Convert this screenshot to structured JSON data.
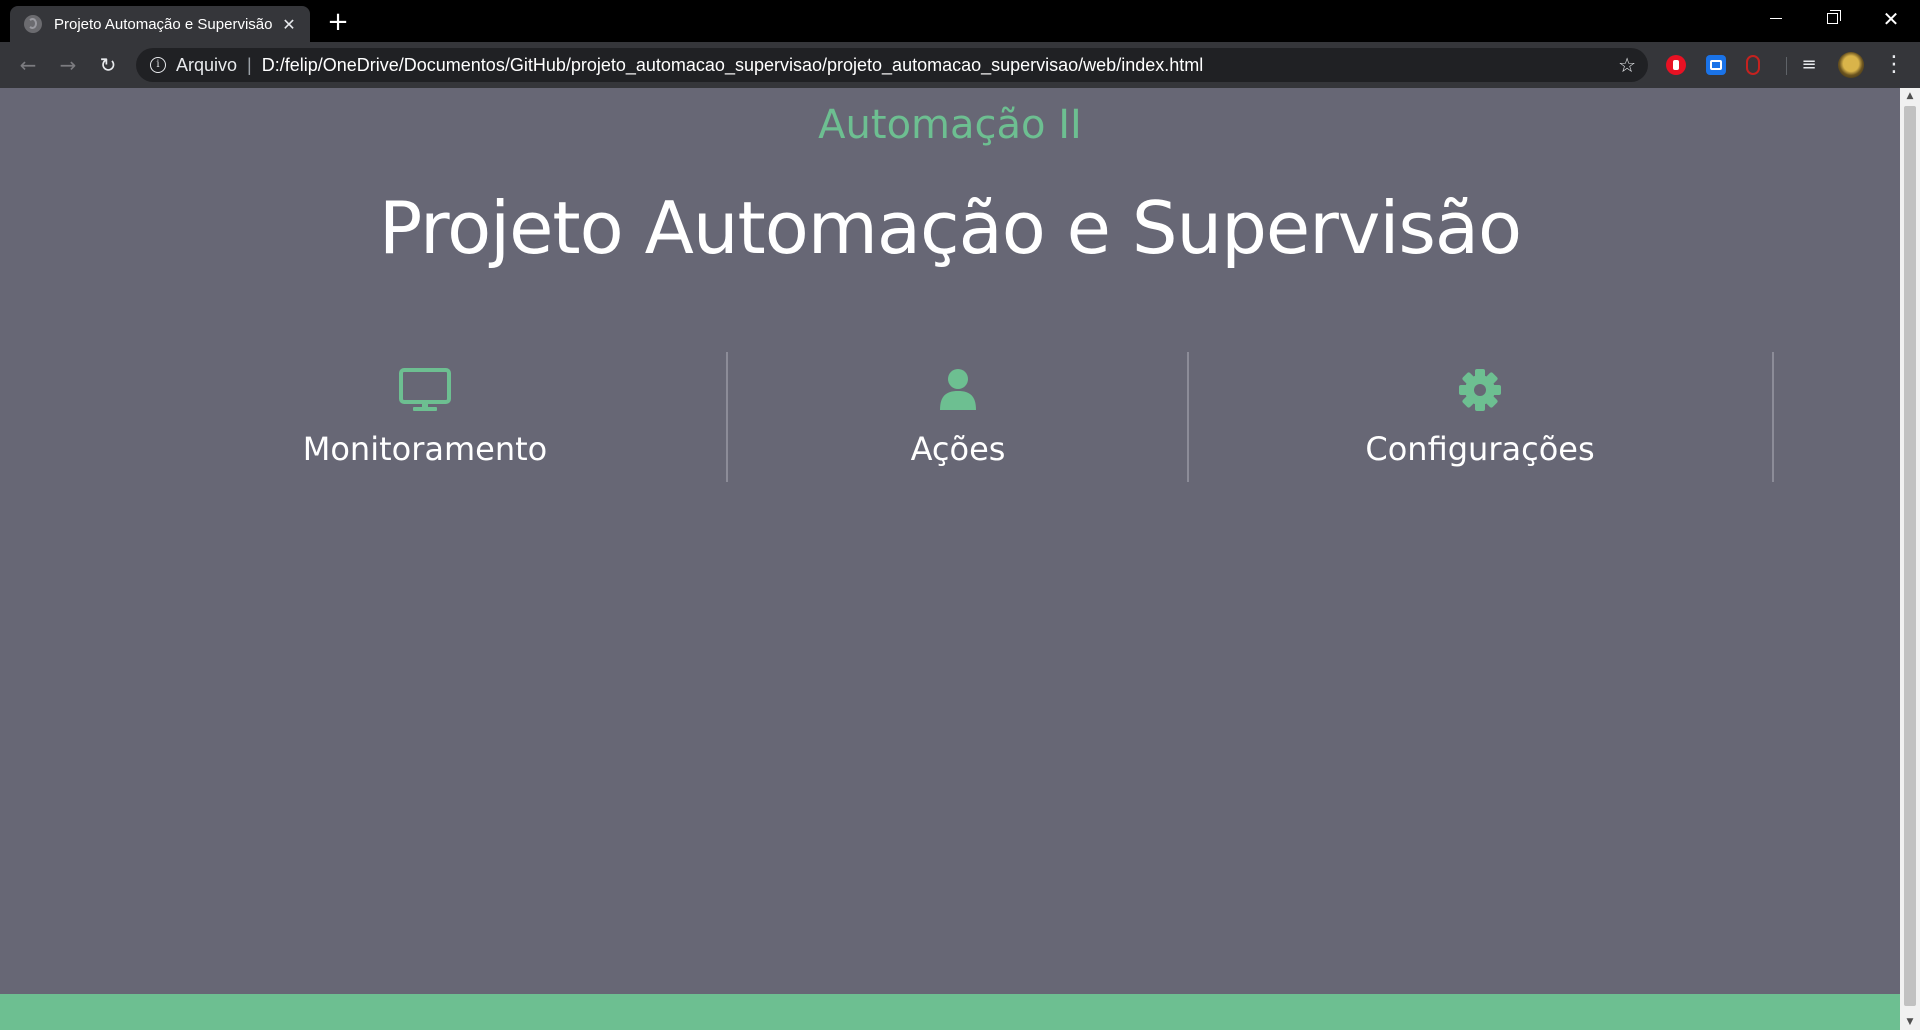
{
  "tab": {
    "title": "Projeto Automação e Supervisão",
    "close_glyph": "✕",
    "favicon": "globe-icon"
  },
  "new_tab_glyph": "+",
  "window_controls": {
    "minimize": "minimize-icon",
    "maximize": "restore-icon",
    "close_glyph": "✕"
  },
  "toolbar": {
    "back_glyph": "←",
    "forward_glyph": "→",
    "reload_glyph": "↻",
    "origin_label": "Arquivo",
    "separator": "|",
    "url": "D:/felip/OneDrive/Documentos/GitHub/projeto_automacao_supervisao/projeto_automacao_supervisao/web/index.html",
    "star_glyph": "☆",
    "media_glyph": "≡",
    "menu_glyph": "⋮"
  },
  "page": {
    "subtitle": "Automação II",
    "title": "Projeto Automação e Supervisão",
    "menu": [
      {
        "label": "Monitoramento",
        "icon": "monitor-icon"
      },
      {
        "label": "Ações",
        "icon": "user-icon"
      },
      {
        "label": "Configurações",
        "icon": "gear-icon"
      }
    ]
  },
  "colors": {
    "page_background": "#676775",
    "accent": "#6dbf91",
    "text": "#ffffff",
    "chrome_dark": "#35363a"
  },
  "scrollbar": {
    "up_glyph": "▲",
    "down_glyph": "▼"
  }
}
